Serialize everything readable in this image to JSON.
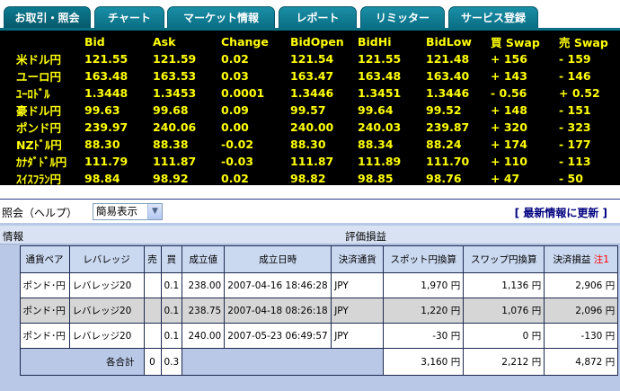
{
  "tabs": [
    {
      "label": "お取引・照会",
      "active": true
    },
    {
      "label": "チャート",
      "active": false
    },
    {
      "label": "マーケット情報",
      "active": false
    },
    {
      "label": "レポート",
      "active": false
    },
    {
      "label": "リミッター",
      "active": false
    },
    {
      "label": "サービス登録",
      "active": false
    }
  ],
  "rates": {
    "headers": [
      "Bid",
      "Ask",
      "Change",
      "BidOpen",
      "BidHi",
      "BidLow",
      "買 Swap",
      "売 Swap"
    ],
    "rows": [
      {
        "pair": "米ドル円",
        "bid": "121.55",
        "ask": "121.59",
        "change": "0.02",
        "open": "121.54",
        "hi": "121.55",
        "low": "121.48",
        "buy_swap": "+ 156",
        "sell_swap": "- 159"
      },
      {
        "pair": "ユーロ円",
        "bid": "163.48",
        "ask": "163.53",
        "change": "0.03",
        "open": "163.47",
        "hi": "163.48",
        "low": "163.40",
        "buy_swap": "+ 143",
        "sell_swap": "- 146"
      },
      {
        "pair": "ﾕｰﾛﾄﾞﾙ",
        "bid": "1.3448",
        "ask": "1.3453",
        "change": "0.0001",
        "open": "1.3446",
        "hi": "1.3451",
        "low": "1.3446",
        "buy_swap": "- 0.56",
        "sell_swap": "+ 0.52"
      },
      {
        "pair": "豪ドル円",
        "bid": "99.63",
        "ask": "99.68",
        "change": "0.09",
        "open": "99.57",
        "hi": "99.64",
        "low": "99.52",
        "buy_swap": "+ 148",
        "sell_swap": "- 151"
      },
      {
        "pair": "ポンド円",
        "bid": "239.97",
        "ask": "240.06",
        "change": "0.00",
        "open": "240.00",
        "hi": "240.03",
        "low": "239.87",
        "buy_swap": "+ 320",
        "sell_swap": "- 323"
      },
      {
        "pair": "NZﾄﾞﾙ円",
        "bid": "88.30",
        "ask": "88.38",
        "change": "-0.02",
        "open": "88.30",
        "hi": "88.34",
        "low": "88.24",
        "buy_swap": "+ 174",
        "sell_swap": "- 177"
      },
      {
        "pair": "ｶﾅﾀﾞﾄﾞﾙ円",
        "bid": "111.79",
        "ask": "111.87",
        "change": "-0.03",
        "open": "111.87",
        "hi": "111.89",
        "low": "111.70",
        "buy_swap": "+ 110",
        "sell_swap": "- 113"
      },
      {
        "pair": "ｽｲｽﾌﾗﾝ円",
        "bid": "98.84",
        "ask": "98.92",
        "change": "0.02",
        "open": "98.82",
        "hi": "98.85",
        "low": "98.76",
        "buy_swap": "+ 47",
        "sell_swap": "- 50"
      }
    ]
  },
  "panel": {
    "title": "照会（ヘルプ）",
    "view_select": "簡易表示",
    "refresh_link": "[ 最新情報に更新 ]",
    "section_left": "情報",
    "section_right": "評価損益"
  },
  "grid": {
    "headers": [
      "通貨ペア",
      "レバレッジ",
      "売",
      "買",
      "成立値",
      "成立日時",
      "決済通貨",
      "スポット円換算",
      "スワップ円換算",
      "決済損益"
    ],
    "note": "注1",
    "rows": [
      {
        "pair": "ポンド･円",
        "leverage": "レバレッジ20",
        "sell": "",
        "buy": "0.1",
        "price": "238.00",
        "datetime": "2007-04-16 18:46:28",
        "currency": "JPY",
        "spot": "1,970 円",
        "swap": "1,136 円",
        "pl": "2,906 円",
        "spot_neg": false,
        "pl_neg": false
      },
      {
        "pair": "ポンド･円",
        "leverage": "レバレッジ20",
        "sell": "",
        "buy": "0.1",
        "price": "238.75",
        "datetime": "2007-04-18 08:26:18",
        "currency": "JPY",
        "spot": "1,220 円",
        "swap": "1,076 円",
        "pl": "2,096 円",
        "spot_neg": false,
        "pl_neg": false
      },
      {
        "pair": "ポンド･円",
        "leverage": "レバレッジ20",
        "sell": "",
        "buy": "0.1",
        "price": "240.00",
        "datetime": "2007-05-23 06:49:57",
        "currency": "JPY",
        "spot": "-30 円",
        "swap": "0 円",
        "pl": "-130 円",
        "spot_neg": true,
        "pl_neg": true
      }
    ],
    "total": {
      "label": "各合計",
      "sell": "0",
      "buy": "0.3",
      "spot": "3,160 円",
      "swap": "2,212 円",
      "pl": "4,872 円"
    }
  },
  "colors": {
    "tab": "#0a6f85",
    "board_bg": "#000000",
    "board_text": "#ffff00",
    "panel_bg": "#b8c8e6",
    "negative": "#ff0000"
  }
}
